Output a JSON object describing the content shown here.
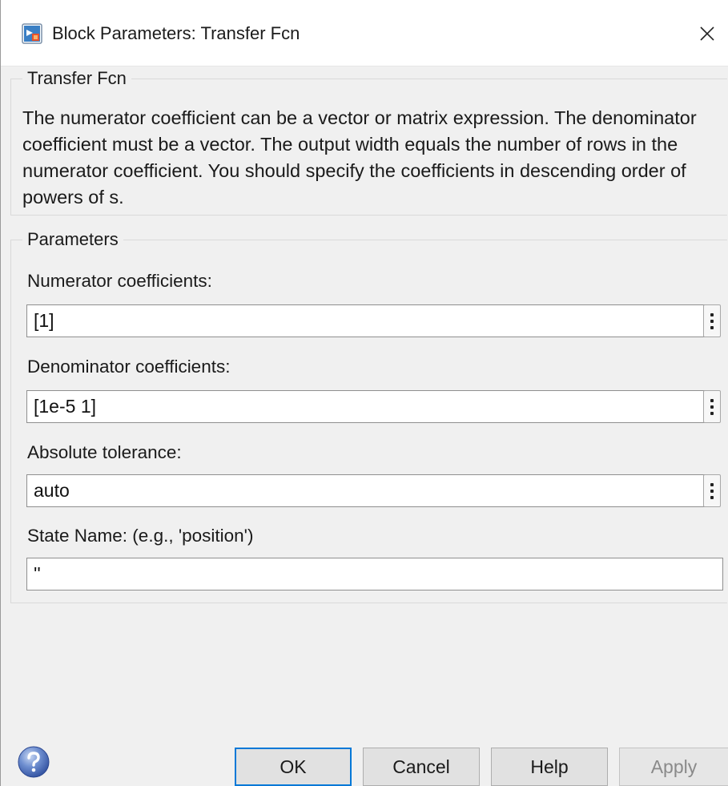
{
  "window": {
    "title": "Block Parameters: Transfer Fcn",
    "icon": "simulink-block-icon",
    "close_icon": "close-icon"
  },
  "block_section": {
    "legend": "Transfer Fcn",
    "description": "The numerator coefficient can be a vector or matrix expression. The denominator coefficient must be a vector. The output width equals the number of rows in the numerator coefficient. You should specify the coefficients in descending order of powers of s."
  },
  "parameters": {
    "legend": "Parameters",
    "fields": [
      {
        "label": "Numerator coefficients:",
        "value": "[1]",
        "has_menu": true
      },
      {
        "label": "Denominator coefficients:",
        "value": "[1e-5 1]",
        "has_menu": true
      },
      {
        "label": "Absolute tolerance:",
        "value": "auto",
        "has_menu": true
      },
      {
        "label": "State Name: (e.g., 'position')",
        "value": "''",
        "has_menu": false
      }
    ]
  },
  "footer": {
    "help_icon": "help-question-icon",
    "ok_label": "OK",
    "cancel_label": "Cancel",
    "help_label": "Help",
    "apply_label": "Apply",
    "apply_enabled": false
  },
  "colors": {
    "window_bg": "#f0f0f0",
    "titlebar_bg": "#ffffff",
    "default_button_border": "#0078d7",
    "disabled_text": "#8a8a8a"
  }
}
